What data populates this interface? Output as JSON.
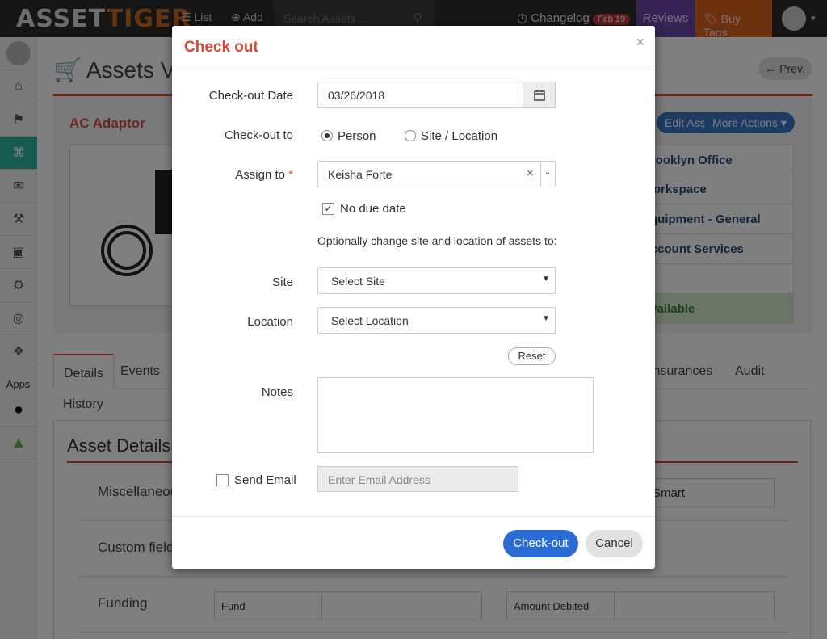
{
  "topbar": {
    "logo_a": "ASSET",
    "logo_b": "TIGER",
    "list": "List",
    "add": "Add",
    "search_placeholder": "Search Assets ...",
    "changelog": "Changelog",
    "changelog_badge": "Feb 19",
    "reviews": "Reviews",
    "buy_tags": "Buy Tags"
  },
  "sidebar": {
    "apps": "Apps"
  },
  "page": {
    "title": "Assets View",
    "prev": "Prev.",
    "asset_name": "AC Adaptor",
    "action_edit": "Edit Asset",
    "action_more": "More Actions",
    "info": [
      "Brooklyn Office",
      "Workspace",
      "Equipment - General",
      "Account Services",
      "",
      "Available"
    ],
    "tabs": [
      "Details",
      "Events",
      "Insurances",
      "Audit"
    ],
    "history": "History",
    "details_title": "Asset Details",
    "rows": {
      "misc": "Miscellaneous",
      "misc_field": "Smart",
      "custom": "Custom fields",
      "funding": "Funding",
      "fund": "Fund",
      "amount_debited": "Amount Debited"
    }
  },
  "modal": {
    "title": "Check out",
    "close": "×",
    "checkout_date_label": "Check-out Date",
    "checkout_date": "03/26/2018",
    "checkout_to_label": "Check-out to",
    "opt_person": "Person",
    "opt_site": "Site / Location",
    "assign_to_label": "Assign to",
    "assign_to_req": "*",
    "assign_to_value": "Keisha Forte",
    "no_due_date": "No due date",
    "optional_text": "Optionally change site and location of assets to:",
    "site_label": "Site",
    "site_value": "Select Site",
    "location_label": "Location",
    "location_value": "Select Location",
    "reset": "Reset",
    "notes_label": "Notes",
    "send_email_label": "Send Email",
    "email_placeholder": "Enter Email Address",
    "checkout_button": "Check-out",
    "cancel_button": "Cancel"
  }
}
